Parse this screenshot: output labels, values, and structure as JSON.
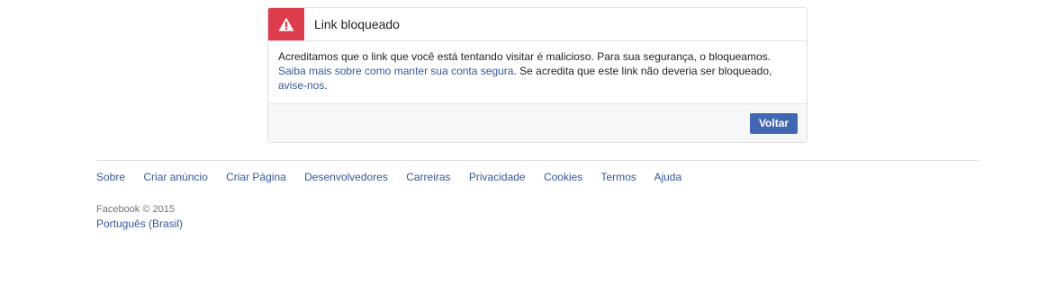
{
  "dialog": {
    "title": "Link bloqueado",
    "icon": "warning-icon",
    "body": {
      "text_1": "Acreditamos que o link que você está tentando visitar é malicioso. Para sua segurança, o bloqueamos.",
      "learn_more_link": "Saiba mais sobre como manter sua conta segura",
      "text_2": ". Se acredita que este link não deveria ser bloqueado,",
      "report_link": "avise-nos",
      "text_3": "."
    },
    "back_button": "Voltar"
  },
  "footer": {
    "links": [
      "Sobre",
      "Criar anúncio",
      "Criar Página",
      "Desenvolvedores",
      "Carreiras",
      "Privacidade",
      "Cookies",
      "Termos",
      "Ajuda"
    ],
    "copyright": "Facebook © 2015",
    "language": "Português (Brasil)"
  },
  "colors": {
    "warning_red": "#dd3c4d",
    "link_blue": "#365899",
    "button_blue": "#4267b2"
  }
}
